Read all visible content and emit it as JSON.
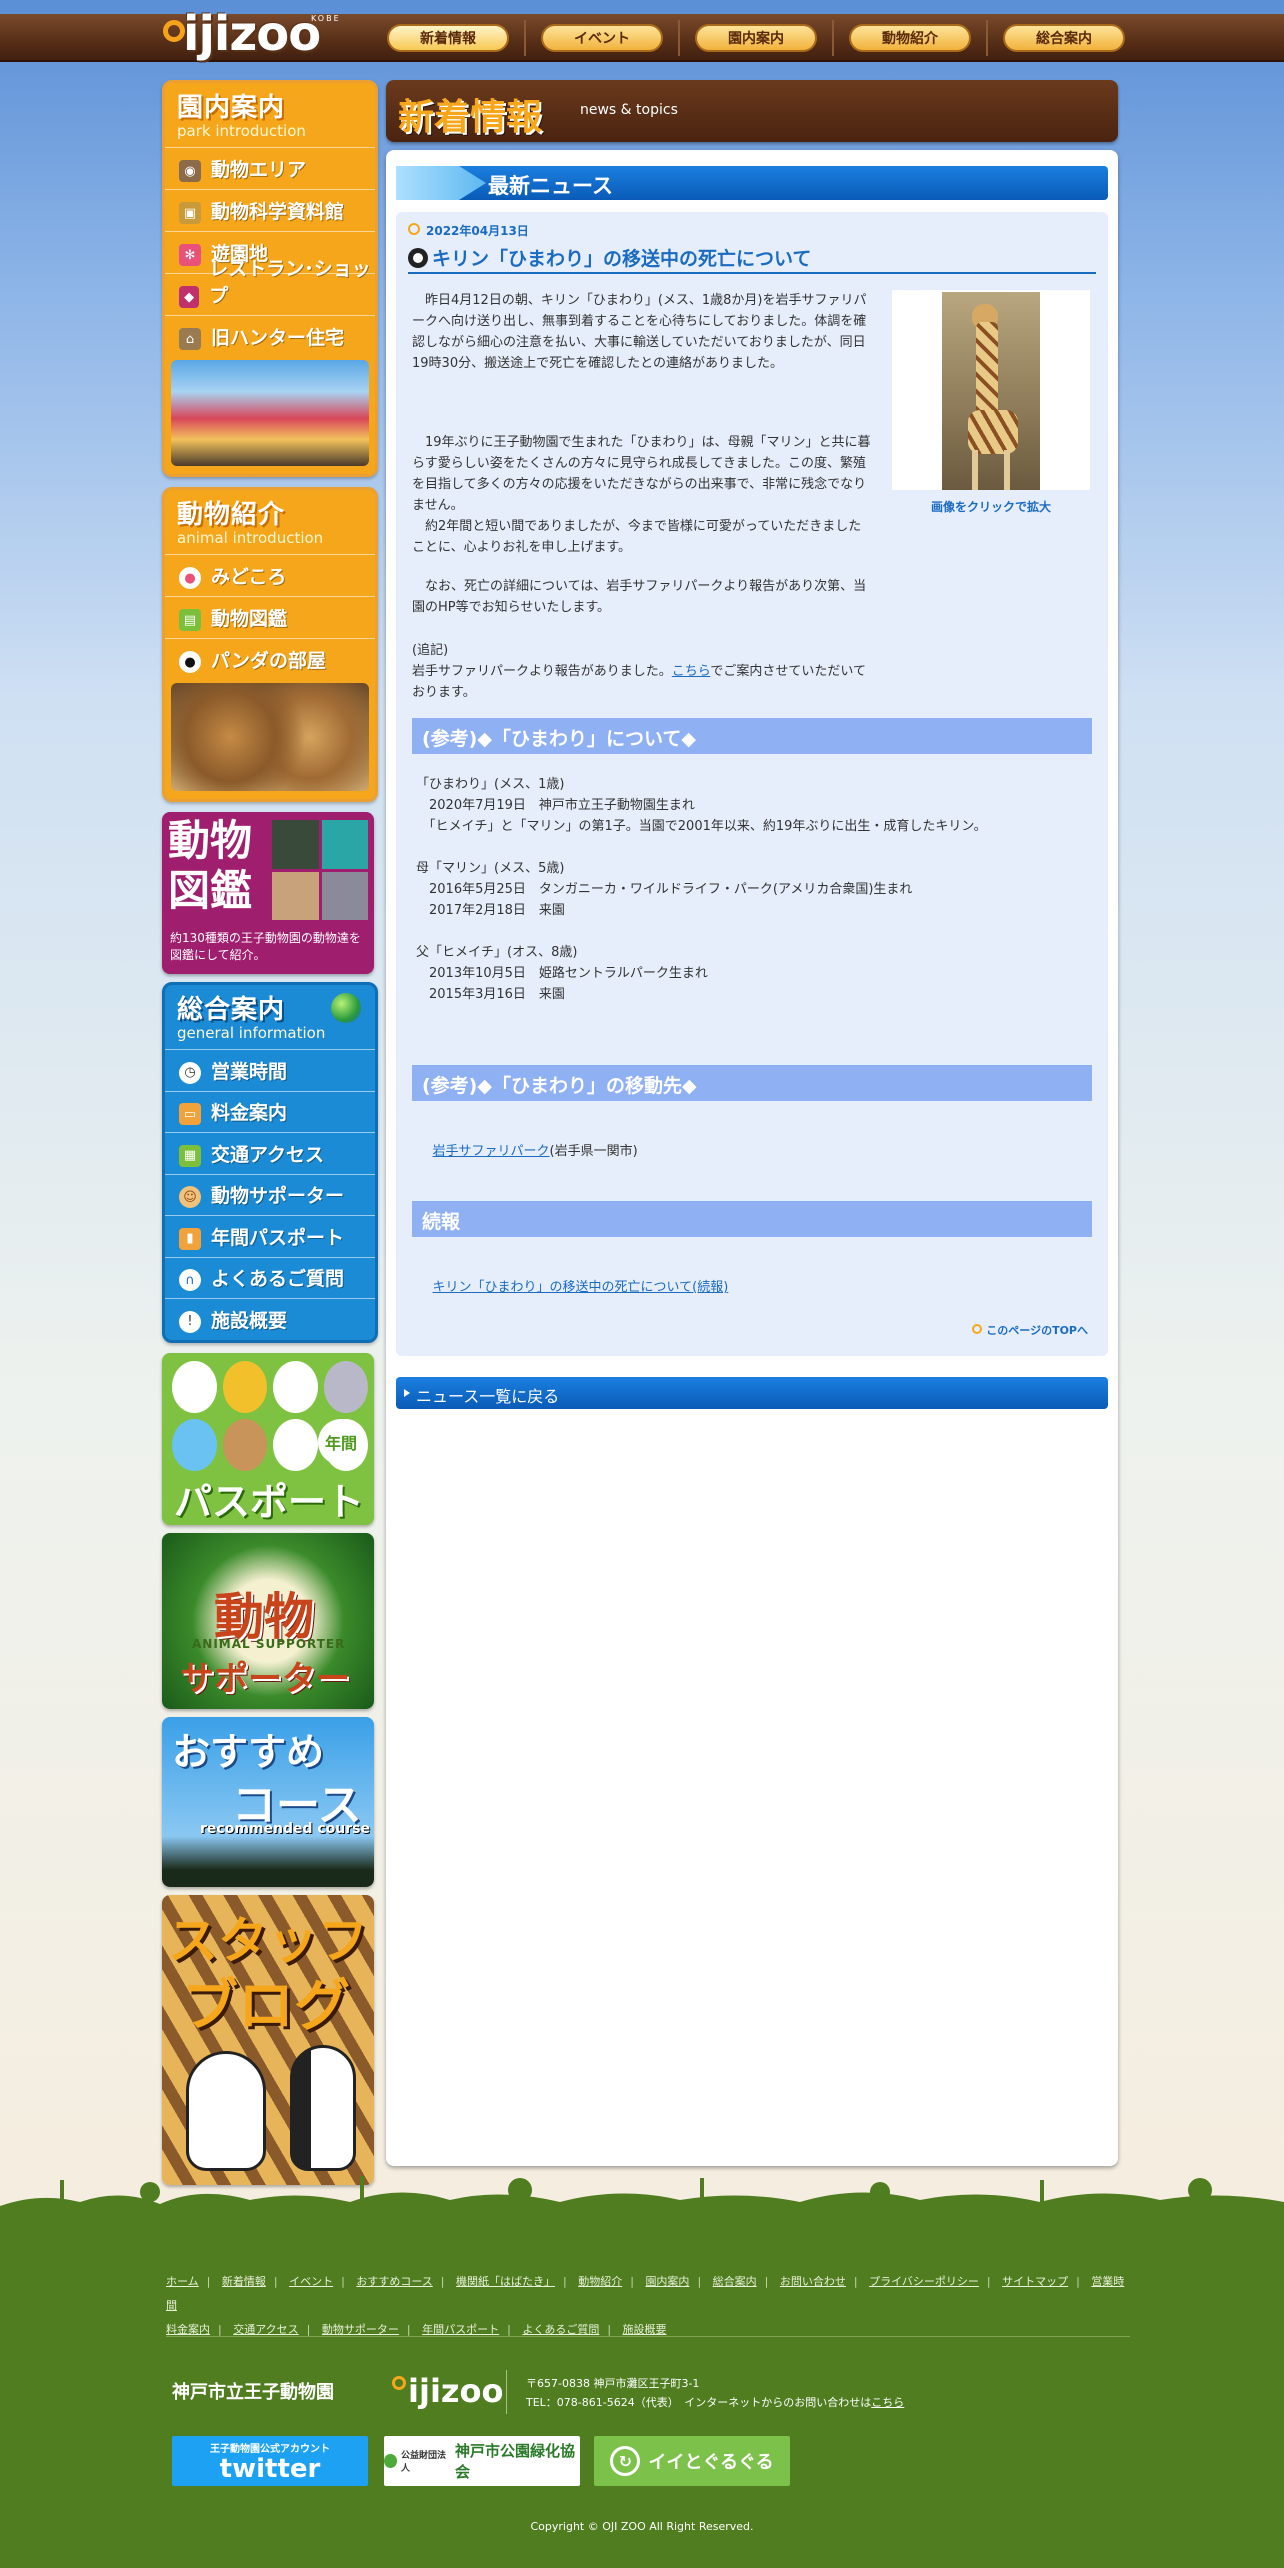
{
  "header": {
    "logo_text": "ijizoo",
    "logo_sub": "KOBE",
    "nav": [
      "新着情報",
      "イベント",
      "園内案内",
      "動物紹介",
      "総合案内"
    ]
  },
  "sidebar": {
    "park": {
      "title": "園内案内",
      "en": "park introduction",
      "items": [
        "動物エリア",
        "動物科学資料館",
        "遊園地",
        "レストラン･ショップ",
        "旧ハンター住宅"
      ]
    },
    "animal": {
      "title": "動物紹介",
      "en": "animal introduction",
      "items": [
        "みどころ",
        "動物図鑑",
        "パンダの部屋"
      ]
    },
    "encyclopedia": {
      "title": "動物図鑑",
      "desc": "約130種類の王子動物園の動物達を図鑑にして紹介。"
    },
    "general": {
      "title": "総合案内",
      "en": "general information",
      "items": [
        "営業時間",
        "料金案内",
        "交通アクセス",
        "動物サポーター",
        "年間パスポート",
        "よくあるご質問",
        "施設概要"
      ]
    },
    "banners": {
      "passport": "パスポート",
      "passport_badge": "年間",
      "supporter_main": "動物",
      "supporter_en": "ANIMAL SUPPORTER",
      "supporter_sub": "サポーター",
      "course_main": "おすすめ",
      "course_sub": "コース",
      "course_en": "recommended course",
      "blog_line1": "スタッフ",
      "blog_line2": "ブログ"
    }
  },
  "main": {
    "title_jp": "新着情報",
    "title_en": "news & topics",
    "section_label": "最新ニュース",
    "article": {
      "date": "2022年04月13日",
      "title": "キリン「ひまわり」の移送中の死亡について",
      "p1": "　昨日4月12日の朝、キリン「ひまわり」(メス、1歳8か月)を岩手サファリパークへ向け送り出し、無事到着することを心待ちにしておりました。体調を確認しながら細心の注意を払い、大事に輸送していただいておりましたが、同日19時30分、搬送途上で死亡を確認したとの連絡がありました。",
      "p2": "　19年ぶりに王子動物園で生まれた「ひまわり」は、母親「マリン」と共に暮らす愛らしい姿をたくさんの方々に見守られ成長してきました。この度、繁殖を目指して多くの方々の応援をいただきながらの出来事で、非常に残念でなりません。",
      "p3": "　約2年間と短い間でありましたが、今まで皆様に可愛がっていただきましたことに、心よりお礼を申し上げます。",
      "p4": "　なお、死亡の詳細については、岩手サファリパークより報告があり次第、当園のHP等でお知らせいたします。",
      "p5_head": "(追記)",
      "p5_pre": "岩手サファリパークより報告がありました。",
      "p5_link": "こちら",
      "p5_post": "でご案内させていただいております。",
      "image_caption": "画像をクリックで拡大",
      "ref1_title": "(参考)◆「ひまわり」について◆",
      "ref1_body": "「ひまわり」(メス、1歳)\n　2020年7月19日　神戸市立王子動物園生まれ\n　「ヒメイチ」と「マリン」の第1子。当園で2001年以来、約19年ぶりに出生・成育したキリン。\n\n母「マリン」(メス、5歳)\n　2016年5月25日　タンガニーカ・ワイルドライフ・パーク(アメリカ合衆国)生まれ\n　2017年2月18日　来園\n\n父「ヒメイチ」(オス、8歳)\n　2013年10月5日　姫路セントラルパーク生まれ\n　2015年3月16日　来園",
      "ref2_title": "(参考)◆「ひまわり」の移動先◆",
      "ref2_link": "岩手サファリパーク",
      "ref2_post": "(岩手県一関市)",
      "ref3_title": "続報",
      "ref3_link": "キリン「ひまわり」の移送中の死亡について(続報)",
      "pagetop": "このページのTOPへ"
    },
    "back_label": "ニュース一覧に戻る"
  },
  "footer": {
    "links_row1": [
      "ホーム",
      "新着情報",
      "イベント",
      "おすすめコース",
      "機関紙「はばたき」",
      "動物紹介",
      "園内案内",
      "総合案内",
      "お問い合わせ",
      "プライバシーポリシー",
      "サイトマップ",
      "営業時間"
    ],
    "links_row2": [
      "料金案内",
      "交通アクセス",
      "動物サポーター",
      "年間パスポート",
      "よくあるご質問",
      "施設概要"
    ],
    "zoo_name": "神戸市立王子動物園",
    "logo": "ijizoo",
    "address": "〒657-0838 神戸市灘区王子町3-1",
    "tel": "TEL：078-861-5624（代表）　インターネットからのお問い合わせは",
    "tel_link": "こちら",
    "banner_twitter_top": "王子動物園公式アカウント",
    "banner_twitter": "twitter",
    "banner_park": "神戸市公園緑化協会",
    "banner_park_pre": "公益財団法人",
    "banner_app": "イイとぐるぐる",
    "copyright": "Copyright © OJI ZOO All Right Reserved."
  },
  "colors": {
    "accent_orange": "#f6a61a",
    "accent_blue": "#1a6bc2",
    "header_brown": "#5a3119",
    "footer_green": "#4f7d1f"
  }
}
